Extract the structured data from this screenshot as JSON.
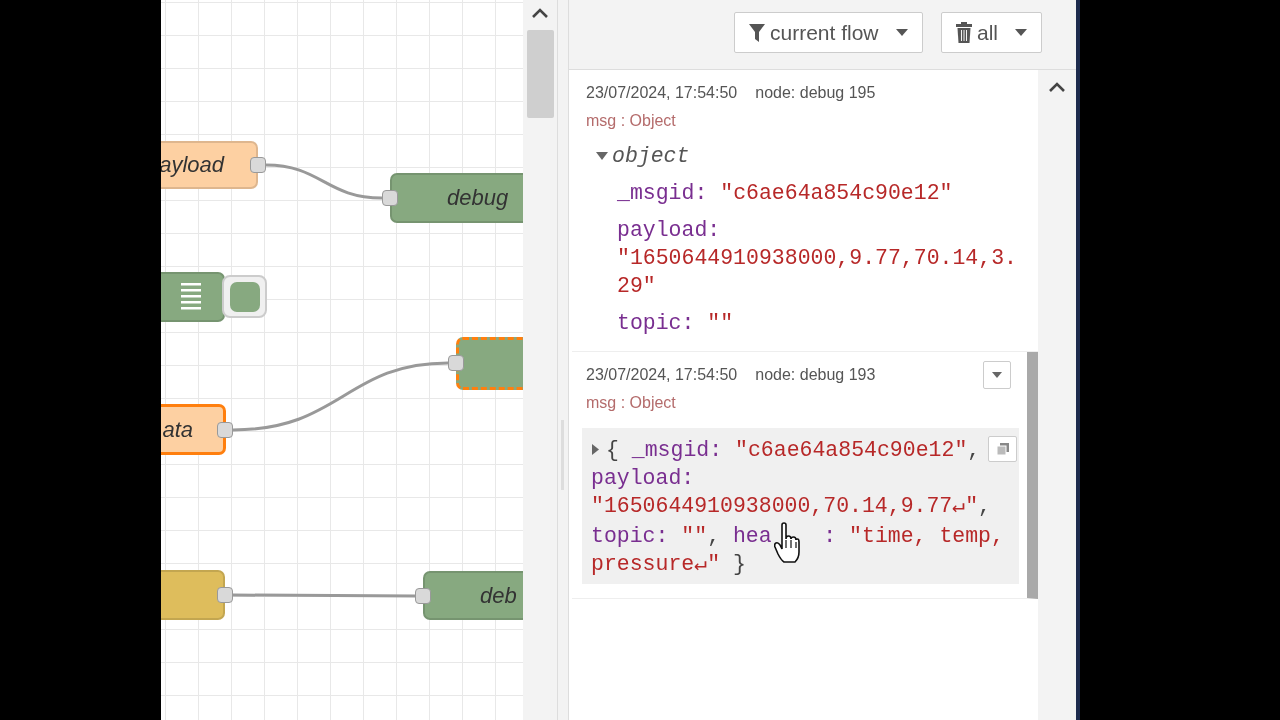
{
  "canvas": {
    "nodes": [
      {
        "kind": "labelled",
        "label": "ayload",
        "color": "#fdd0a2",
        "selected": false,
        "has_input": false,
        "has_output": true
      },
      {
        "kind": "labelled",
        "label": "debug",
        "color": "#87a980",
        "selected": false,
        "has_input": true,
        "has_output": false
      },
      {
        "kind": "switch",
        "color": "#87a980",
        "selected": false,
        "has_input": false,
        "has_output": false
      },
      {
        "kind": "labelled",
        "color": "#87a980",
        "selected": true,
        "moving": true,
        "has_input": true,
        "has_output": false
      },
      {
        "kind": "labelled",
        "label": "ata",
        "color": "#fdd0a2",
        "selected": true,
        "has_input": false,
        "has_output": true
      },
      {
        "kind": "labelled",
        "color": "#debd5c",
        "selected": false,
        "has_input": false,
        "has_output": true
      },
      {
        "kind": "labelled",
        "label": "deb",
        "color": "#87a980",
        "selected": false,
        "has_input": true,
        "has_output": false
      }
    ]
  },
  "sidebar": {
    "filters": [
      {
        "kind": "filter",
        "label": "current flow"
      },
      {
        "kind": "clear",
        "label": "all"
      }
    ],
    "messages": [
      {
        "time": "23/07/2024, 17:54:50",
        "node": "node: debug 195",
        "type": "msg : Object",
        "kind": "tree",
        "hovered": false,
        "root": "object",
        "expanded": true,
        "properties": [
          {
            "key": "_msgid:",
            "value": "\"c6ae64a854c90e12\""
          },
          {
            "key": "payload:",
            "value": "\"1650644910938000,9.77,70.14,3.29\""
          },
          {
            "key": "topic:",
            "value": "\"\""
          }
        ]
      },
      {
        "time": "23/07/2024, 17:54:50",
        "node": "node: debug 193",
        "type": "msg : Object",
        "kind": "preview",
        "hovered": true,
        "expanded": false,
        "tokens": [
          {
            "kind": "open",
            "text": "{"
          },
          {
            "kind": "key",
            "text": "_msgid:"
          },
          {
            "kind": "str",
            "text": "\"c6ae64a854c90e12\""
          },
          {
            "kind": "sep",
            "text": ","
          },
          {
            "kind": "key",
            "text": "payload:"
          },
          {
            "kind": "str",
            "text": "\"1650644910938000,70.14,9.77↵\""
          },
          {
            "kind": "sep",
            "text": ","
          },
          {
            "kind": "key",
            "text": "topic:"
          },
          {
            "kind": "str",
            "text": "\"\""
          },
          {
            "kind": "sep",
            "text": ","
          },
          {
            "kind": "key",
            "text": "hea"
          },
          {
            "kind": "cursor"
          },
          {
            "kind": "key",
            "text": ":"
          },
          {
            "kind": "str",
            "text": "\"time, temp,"
          },
          {
            "kind": "str",
            "text": "pressure↵\""
          },
          {
            "kind": "close",
            "text": "}"
          }
        ]
      }
    ]
  }
}
